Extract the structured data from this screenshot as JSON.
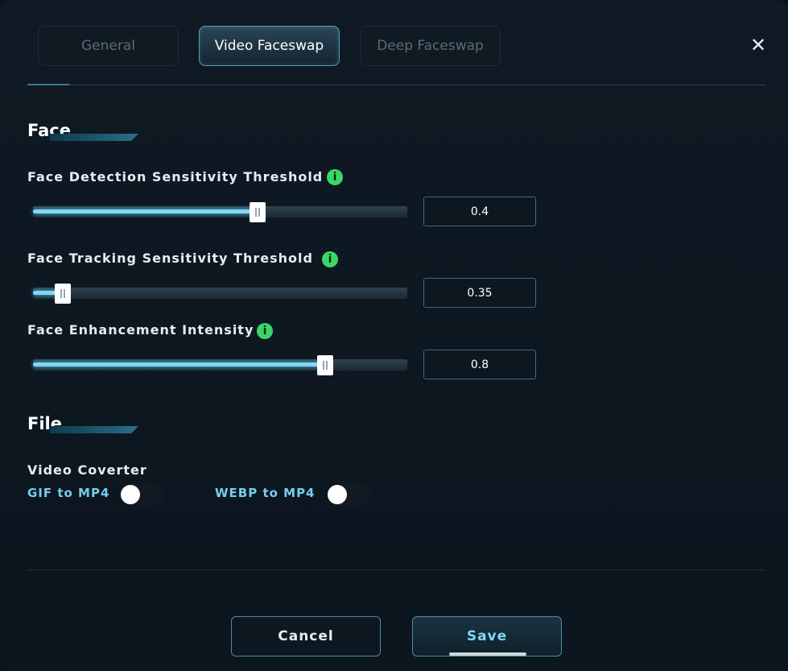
{
  "tabs": [
    {
      "label": "General",
      "active": false
    },
    {
      "label": "Video Faceswap",
      "active": true
    },
    {
      "label": "Deep Faceswap",
      "active": false
    }
  ],
  "close_icon": "close-icon",
  "sections": {
    "face": {
      "title": "Face",
      "settings": [
        {
          "label": "Face Detection Sensitivity Threshold",
          "value": "0.4",
          "level": 0.6
        },
        {
          "label": "Face Tracking Sensitivity Threshold",
          "value": "0.35",
          "level": 0.08
        },
        {
          "label": "Face Enhancement Intensity",
          "value": "0.8",
          "level": 0.78
        }
      ],
      "info_icon": "i"
    },
    "file": {
      "title": "File",
      "group_label": "Video Coverter",
      "toggles": [
        {
          "label": "GIF to MP4",
          "on": false
        },
        {
          "label": "WEBP to MP4",
          "on": false
        }
      ]
    }
  },
  "footer": {
    "cancel_label": "Cancel",
    "save_label": "Save"
  },
  "colors": {
    "accent": "#7fd8f6",
    "info": "#3bd66a",
    "background": "#0b1219"
  }
}
